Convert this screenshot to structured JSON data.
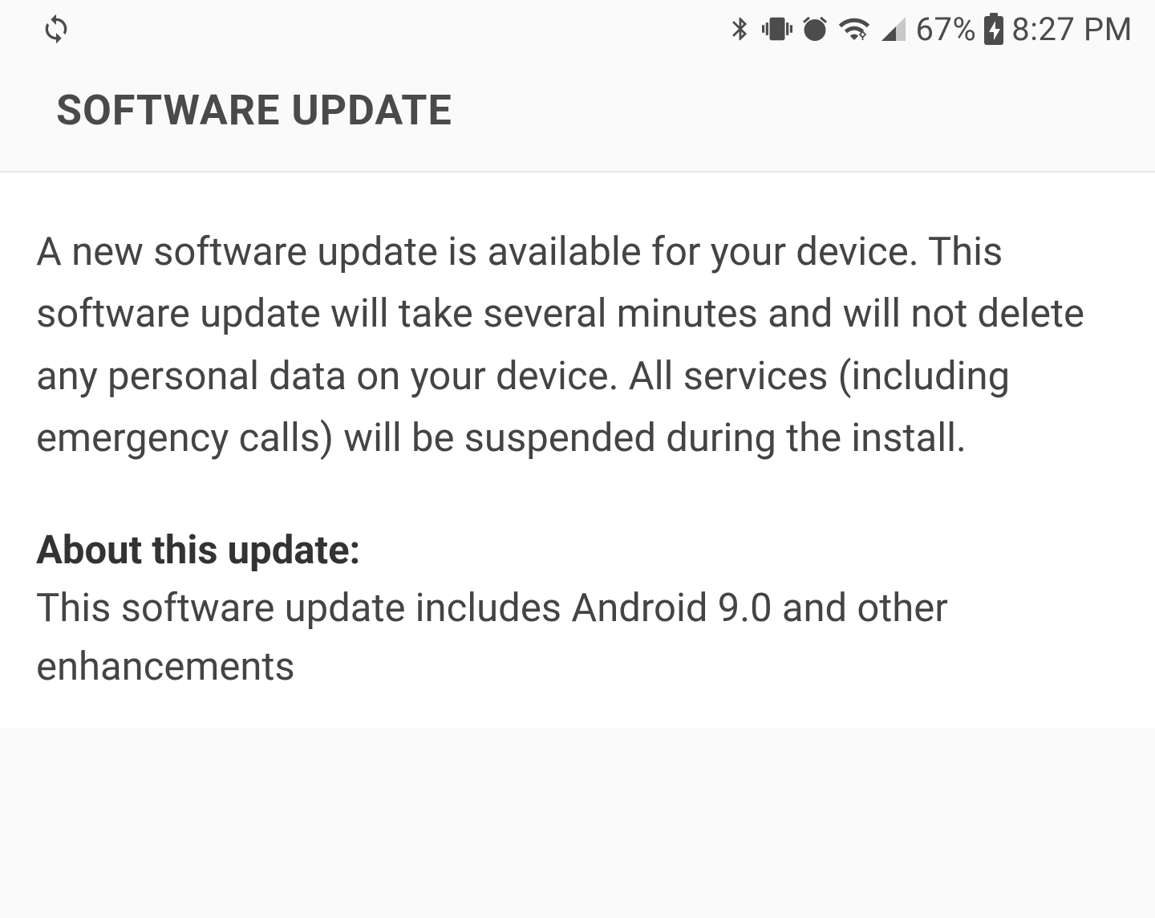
{
  "status_bar": {
    "battery_percent": "67%",
    "time": "8:27 PM"
  },
  "header": {
    "title": "SOFTWARE UPDATE"
  },
  "content": {
    "intro": "A new software update is available for your device. This software update will take several minutes and will not delete any personal data on your device. All services (including emergency calls) will be suspended during the install.",
    "about_heading": "About this update:",
    "about_body": "This software update includes Android 9.0 and other enhancements"
  }
}
